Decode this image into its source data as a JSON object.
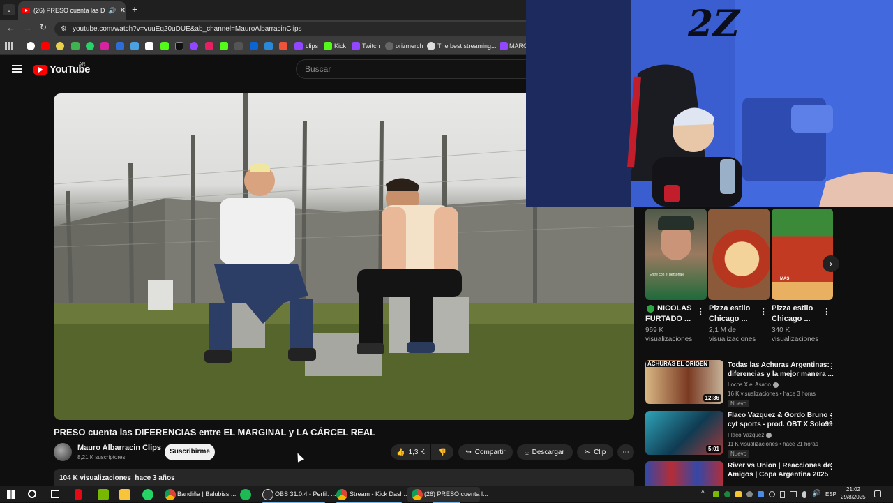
{
  "browser": {
    "tab_title": "(26) PRESO cuenta las DIFERE",
    "url": "youtube.com/watch?v=vuuEq20uDUE&ab_channel=MauroAlbarracinClips",
    "bookmarks": [
      "clips",
      "Kick",
      "Twitch",
      "orizmerch",
      "The best streaming...",
      "MARCO"
    ]
  },
  "youtube": {
    "logo": "YouTube",
    "country": "AR",
    "search_placeholder": "Buscar"
  },
  "video": {
    "title": "PRESO cuenta las DIFERENCIAS entre EL MARGINAL y LA CÁRCEL REAL",
    "channel": "Mauro Albarracin Clips",
    "subscribers": "8,21 K suscriptores",
    "subscribe_label": "Suscribirme",
    "likes": "1,3 K",
    "share_label": "Compartir",
    "download_label": "Descargar",
    "clip_label": "Clip",
    "description_line": "104 K visualizaciones  hace 3 años"
  },
  "shorts": [
    {
      "title_1": "NICOLAS",
      "title_2": "FURTADO ...",
      "views_1": "969 K",
      "views_2": "visualizaciones",
      "thumb_text": "Entré con el personaje"
    },
    {
      "title_1": "Pizza estilo",
      "title_2": "Chicago ...",
      "views_1": "2,1 M de",
      "views_2": "visualizaciones"
    },
    {
      "title_1": "Pizza estilo",
      "title_2": "Chicago ...",
      "views_1": "340 K",
      "views_2": "visualizaciones",
      "thumb_text": "MAS"
    }
  ],
  "recommended": [
    {
      "thumb_text": "ACHURAS EL ORIGEN",
      "title_1": "Todas las Achuras Argentinas:",
      "title_2": "diferencias y la mejor manera ...",
      "channel": "Locos X el Asado",
      "stats": "16 K visualizaciones • hace 3 horas",
      "duration": "12:36",
      "badge": "Nuevo"
    },
    {
      "title_1": "Flaco Vazquez & Gordo Bruno -",
      "title_2": "cyt sports - prod. OBT  X Solo99",
      "channel": "Flaco Vazquez",
      "stats": "11 K visualizaciones • hace 21 horas",
      "duration": "5:01",
      "badge": "Nuevo"
    },
    {
      "title_1": "River vs Union | Reacciones de",
      "title_2": "Amigos | Copa Argentina 2025"
    }
  ],
  "taskbar": {
    "items": [
      "Bandiña | Balubiss ...",
      "OBS 31.0.4 - Perfil: ...",
      "Stream - Kick Dash...",
      "(26) PRESO cuenta l..."
    ],
    "lang": "ESP",
    "time": "21:02",
    "date": "29/8/2025"
  },
  "webcam": {
    "wall_text": "2Z"
  },
  "colors": {
    "accent_red": "#ff0000",
    "bg": "#0f0f0f",
    "verified_green": "#2ba640"
  }
}
